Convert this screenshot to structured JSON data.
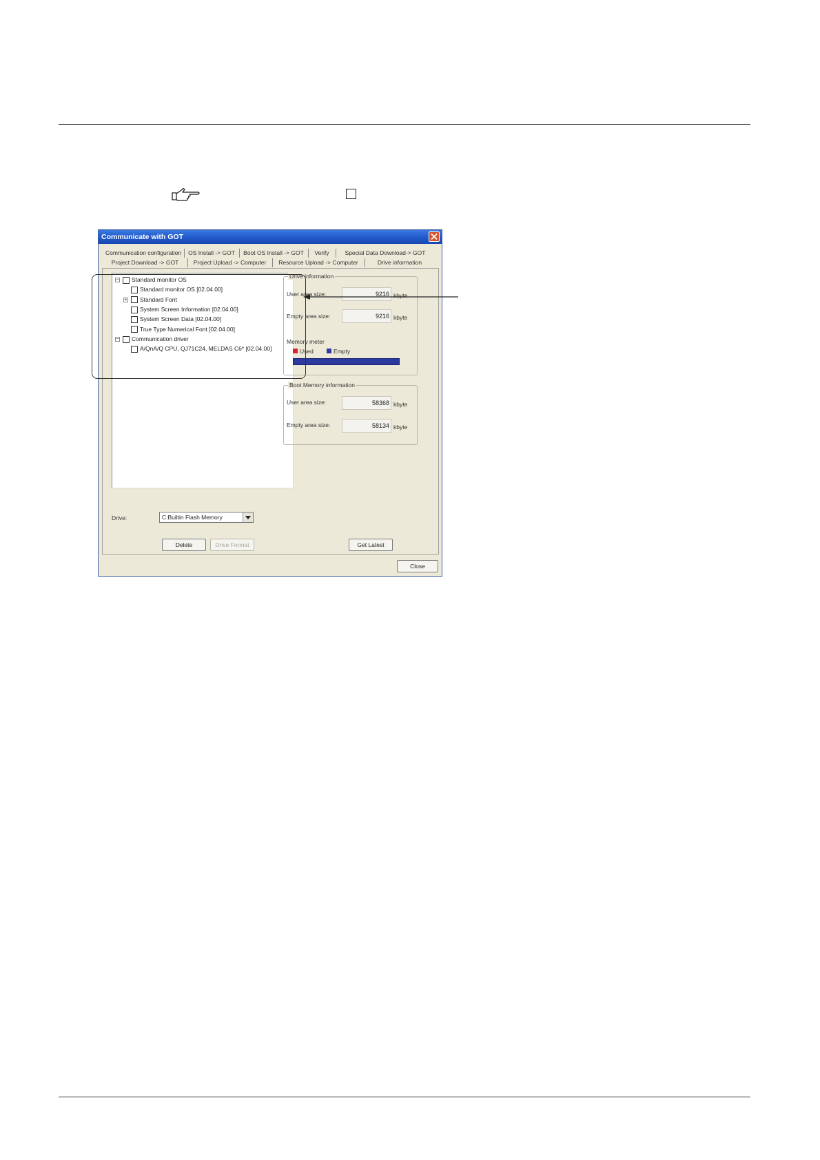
{
  "dialog": {
    "title": "Communicate with GOT",
    "tabs_row1": [
      "Communication configuration",
      "OS Install -> GOT",
      "Boot OS Install -> GOT",
      "Verify",
      "Special Data Download-> GOT"
    ],
    "tabs_row2": [
      "Project Download -> GOT",
      "Project Upload -> Computer",
      "Resource Upload -> Computer",
      "Drive information"
    ],
    "tree": [
      {
        "label": "Standard monitor OS",
        "level": 0,
        "expander": "−"
      },
      {
        "label": "Standard monitor OS [02.04.00]",
        "level": 1,
        "expander": ""
      },
      {
        "label": "Standard Font",
        "level": 1,
        "expander": "+"
      },
      {
        "label": "System Screen Information [02.04.00]",
        "level": 1,
        "expander": ""
      },
      {
        "label": "System Screen Data [02.04.00]",
        "level": 1,
        "expander": ""
      },
      {
        "label": "True Type Numerical Font [02.04.00]",
        "level": 1,
        "expander": ""
      },
      {
        "label": "Communication driver",
        "level": 0,
        "expander": "−"
      },
      {
        "label": "A/QnA/Q CPU, QJ71C24, MELDAS C6* [02.04.00]",
        "level": 1,
        "expander": ""
      }
    ],
    "drive_info": {
      "title": "Drive information",
      "user_area_label": "User area size:",
      "user_area_value": "9216",
      "empty_area_label": "Empty area size:",
      "empty_area_value": "9216",
      "unit": "kbyte",
      "memory_meter_label": "Memory meter",
      "legend_used": "Used",
      "legend_empty": "Empty",
      "used_fraction": 0.0,
      "used_color": "#d8232a",
      "empty_color": "#2c3aa0"
    },
    "boot_info": {
      "title": "Boot Memory information",
      "user_area_label": "User area size:",
      "user_area_value": "58368",
      "empty_area_label": "Empty area size:",
      "empty_area_value": "58134",
      "unit": "kbyte"
    },
    "drive_label": "Drive:",
    "drive_value": "C:Builtin Flash Memory",
    "delete_label": "Delete",
    "drive_format_label": "Drive Format",
    "get_latest_label": "Get Latest",
    "close_label": "Close"
  },
  "icons": {
    "reference": "pointing-hand-icon",
    "reference_box": "square-box-icon",
    "close": "close-icon",
    "dropdown": "chevron-down-icon"
  }
}
